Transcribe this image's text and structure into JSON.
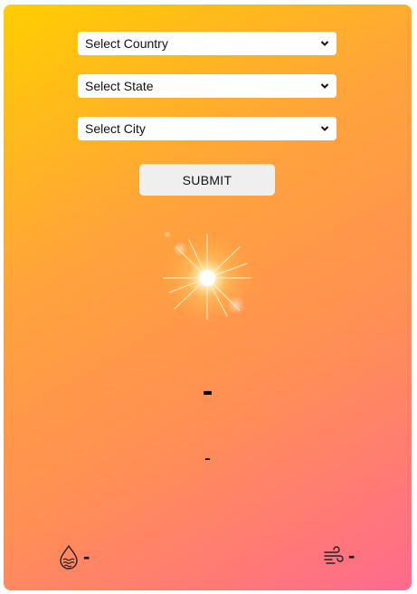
{
  "form": {
    "country": {
      "selected": "Select Country"
    },
    "state": {
      "selected": "Select State"
    },
    "city": {
      "selected": "Select City"
    },
    "submit_label": "SUBMIT"
  },
  "weather": {
    "icon": "sun-icon",
    "temperature": "-",
    "description": "-",
    "humidity": "-",
    "wind": "-"
  },
  "colors": {
    "gradient_start": "#ffce00",
    "gradient_end": "#ff6a8e"
  }
}
